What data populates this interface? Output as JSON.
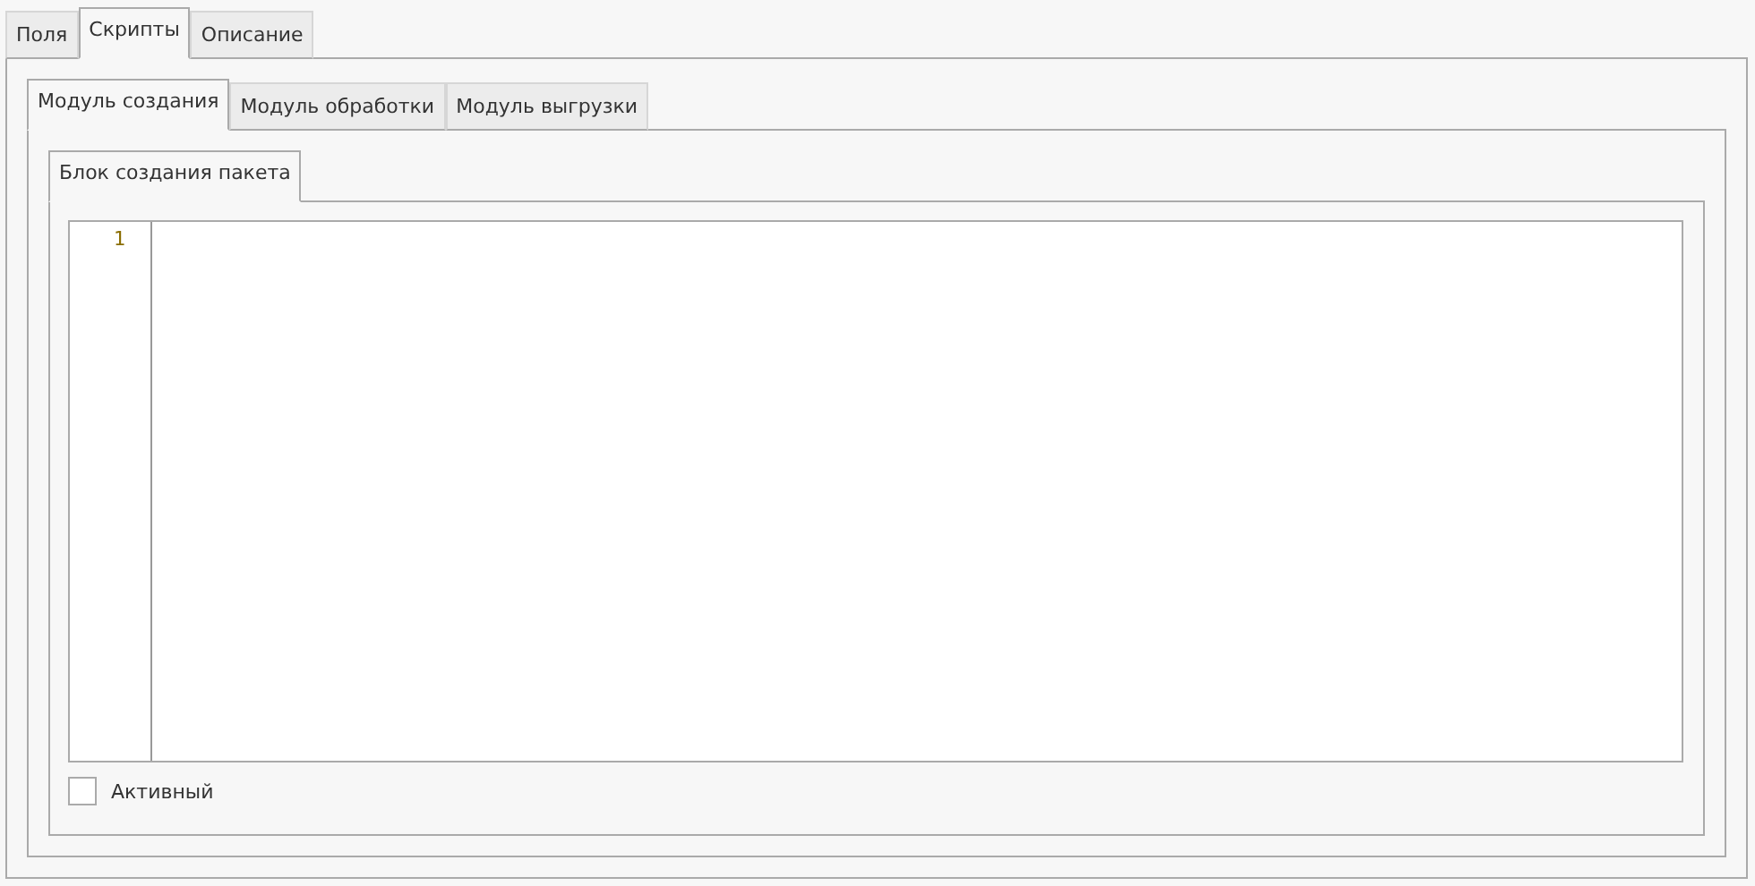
{
  "tabs": [
    {
      "label": "Поля",
      "selected": false
    },
    {
      "label": "Скрипты",
      "selected": true
    },
    {
      "label": "Описание",
      "selected": false
    }
  ],
  "module_tabs": [
    {
      "label": "Модуль создания",
      "selected": true
    },
    {
      "label": "Модуль обработки",
      "selected": false
    },
    {
      "label": "Модуль выгрузки",
      "selected": false
    }
  ],
  "block_tabs": [
    {
      "label": "Блок создания пакета",
      "selected": true
    }
  ],
  "editor": {
    "line_numbers": [
      "1"
    ]
  },
  "active_checkbox": {
    "label": "Активный",
    "checked": false
  }
}
